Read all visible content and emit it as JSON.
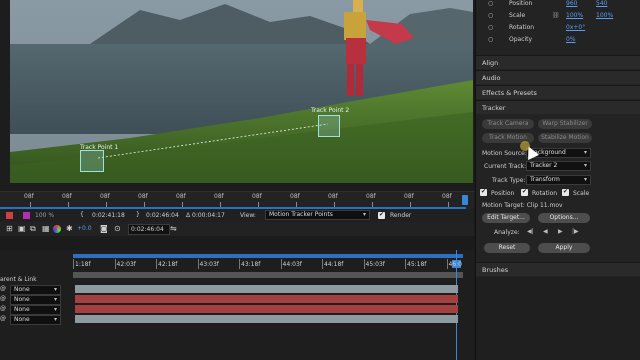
{
  "colors": {
    "accent": "#2d8ceb",
    "playhead": "#3a86d8",
    "red_layer": "#a44040",
    "grey_layer": "#8d9aa0"
  },
  "viewer": {
    "track_point_1": "Track Point 1",
    "track_point_2": "Track Point 2"
  },
  "ruler": {
    "ticks": [
      "08f",
      "08f",
      "08f",
      "08f",
      "08f",
      "08f",
      "08f",
      "08f",
      "08f",
      "08f",
      "08f",
      "08f"
    ]
  },
  "controls": {
    "zoom": "100 %",
    "time_start": "0:02:41:18",
    "time_end": "0:02:46:04",
    "duration": "Δ 0:00:04:17",
    "view_label": "View:",
    "view_value": "Motion Tracker Points",
    "render_label": "Render",
    "exposure": "+0.0",
    "current_time": "0:02:46:04"
  },
  "timeline": {
    "ruler_labels": [
      "1:18f",
      "42:03f",
      "42:18f",
      "43:03f",
      "43:18f",
      "44:03f",
      "44:18f",
      "45:03f",
      "45:18f",
      "46:0"
    ],
    "parent_header": "arent & Link",
    "layers": [
      {
        "parent": "None"
      },
      {
        "parent": "None"
      },
      {
        "parent": "None"
      },
      {
        "parent": "None"
      }
    ]
  },
  "panel": {
    "transform": [
      {
        "label": "Position",
        "v1": "960",
        "v2": "540"
      },
      {
        "label": "Scale",
        "v1": "100%",
        "v2": "100%"
      },
      {
        "label": "Rotation",
        "v1": "0x+0°",
        "v2": ""
      },
      {
        "label": "Opacity",
        "v1": "0%",
        "v2": ""
      }
    ],
    "sections": {
      "align": "Align",
      "audio": "Audio",
      "effects": "Effects & Presets",
      "tracker": "Tracker",
      "brushes": "Brushes"
    },
    "tracker": {
      "track_camera": "Track Camera",
      "warp_stabilizer": "Warp Stabilizer",
      "track_motion": "Track Motion",
      "stabilize_motion": "Stabilize Motion",
      "motion_source_label": "Motion Source:",
      "motion_source": "Background",
      "current_track_label": "Current Track:",
      "current_track": "Tracker 2",
      "track_type_label": "Track Type:",
      "track_type": "Transform",
      "position": "Position",
      "rotation": "Rotation",
      "scale": "Scale",
      "motion_target": "Motion Target: Clip 11.mov",
      "edit_target": "Edit Target...",
      "options": "Options...",
      "analyze": "Analyze:",
      "reset": "Reset",
      "apply": "Apply"
    }
  }
}
